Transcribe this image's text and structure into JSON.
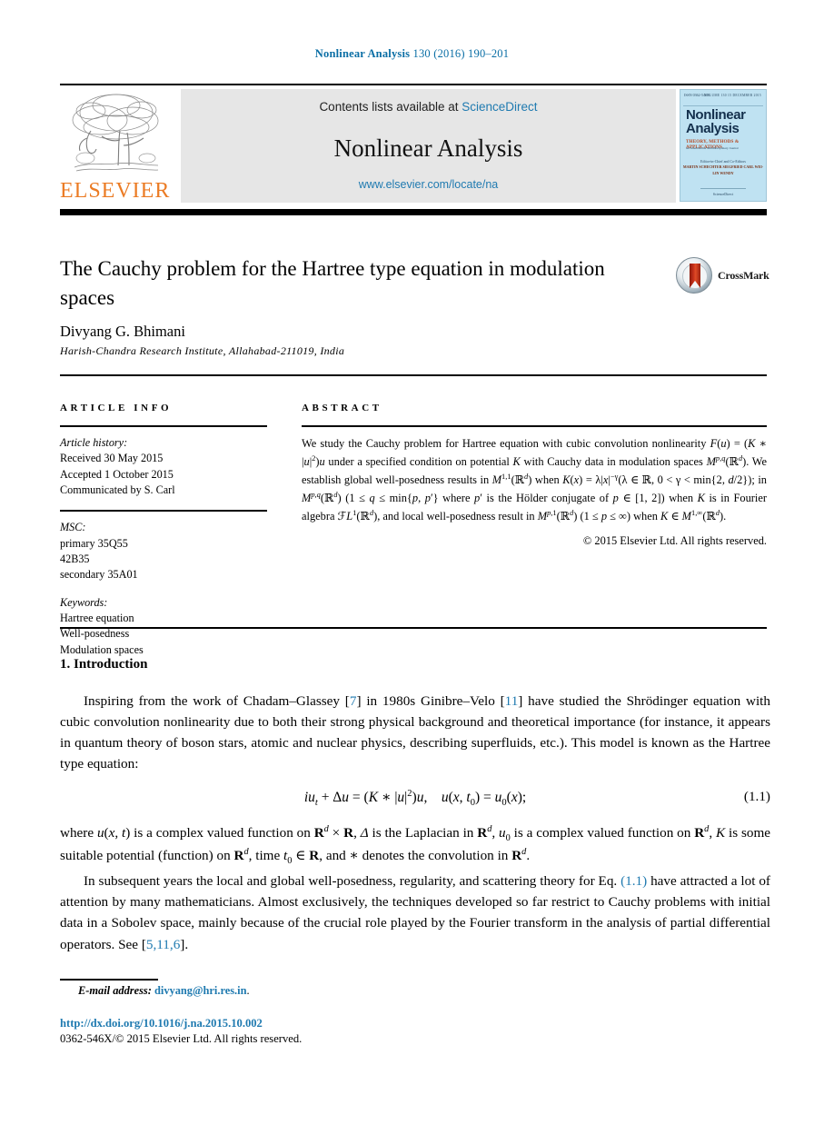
{
  "running_head": {
    "journal": "Nonlinear Analysis",
    "citation": " 130 (2016) 190–201",
    "color": "#0a6ea5"
  },
  "masthead": {
    "publisher_logo_text": "ELSEVIER",
    "publisher_color": "#eb7b24",
    "contents_prefix": "Contents lists available at ",
    "contents_link": "ScienceDirect",
    "journal_title": "Nonlinear Analysis",
    "journal_url": "www.elsevier.com/locate/na",
    "link_color": "#1f7ab0",
    "cover": {
      "issn": "ISSN 0362-546X",
      "meta": "VOLUME 130    15 DECEMBER 2015",
      "title": "Nonlinear Analysis",
      "subtitle": "THEORY, METHODS & APPLICATIONS",
      "subtitle2": "An International Multidisciplinary Journal",
      "editors_label": "Editor-in-Chief and Co-Editors",
      "editors": "MARTIN SCHECHTER\nSIEGFRIED CARL\nWEI-LIN WENDY",
      "footer": "ScienceDirect",
      "bg_color": "#bfe2f2",
      "title_color": "#14304d"
    }
  },
  "article": {
    "title": "The Cauchy problem for the Hartree type equation in modulation spaces",
    "author": "Divyang G. Bhimani",
    "affiliation": "Harish-Chandra Research Institute, Allahabad-211019, India",
    "crossmark_label": "CrossMark"
  },
  "article_info": {
    "heading": "ARTICLE INFO",
    "history_label": "Article history:",
    "history": [
      "Received 30 May 2015",
      "Accepted 1 October 2015",
      "Communicated by S. Carl"
    ],
    "msc_label": "MSC:",
    "msc": [
      "primary 35Q55",
      "42B35",
      "secondary 35A01"
    ],
    "keywords_label": "Keywords:",
    "keywords": [
      "Hartree equation",
      "Well-posedness",
      "Modulation spaces"
    ]
  },
  "abstract": {
    "heading": "ABSTRACT",
    "text_plain": "We study the Cauchy problem for Hartree equation with cubic convolution nonlinearity F(u) = (K * |u|2)u under a specified condition on potential K with Cauchy data in modulation spaces Mp,q(Rd). We establish global well-posedness results in M1,1(Rd) when K(x) = λ|x|−γ(λ ∈ R, 0 < γ < min{2, d/2}); in Mp,q(Rd) (1 ≤ q ≤ min{p, p′} where p′ is the Hölder conjugate of p ∈ [1, 2]) when K is in Fourier algebra FL1(Rd), and local well-posedness result in Mp,1(Rd) (1 ≤ p ≤ ∞) when K ∈ M1,∞(Rd).",
    "copyright": "© 2015 Elsevier Ltd. All rights reserved."
  },
  "section": {
    "number_title": "1. Introduction",
    "paragraph1_plain": "Inspiring from the work of Chadam–Glassey [7] in 1980s Ginibre–Velo [11] have studied the Shrödinger equation with cubic convolution nonlinearity due to both their strong physical background and theoretical importance (for instance, it appears in quantum theory of boson stars, atomic and nuclear physics, describing superfluids, etc.). This model is known as the Hartree type equation:",
    "citation_7": "7",
    "citation_11": "11",
    "equation_number": "(1.1)",
    "equation_plain": "iut + Δu = (K * |u|2)u,    u(x, t0) = u0(x);",
    "paragraph2_plain": "where u(x, t) is a complex valued function on Rd × R, Δ is the Laplacian in Rd, u0 is a complex valued function on Rd, K is some suitable potential (function) on Rd, time t0 ∈ R, and ∗ denotes the convolution in Rd.",
    "paragraph3_plain": "In subsequent years the local and global well-posedness, regularity, and scattering theory for Eq. (1.1) have attracted a lot of attention by many mathematicians. Almost exclusively, the techniques developed so far restrict to Cauchy problems with initial data in a Sobolev space, mainly because of the crucial role played by the Fourier transform in the analysis of partial differential operators. See [5,11,6].",
    "citation_eq": "(1.1)",
    "citation_5116": "5,11,6"
  },
  "footer": {
    "email_label": "E-mail address:",
    "email": "divyang@hri.res.in",
    "email_suffix": ".",
    "doi": "http://dx.doi.org/10.1016/j.na.2015.10.002",
    "issn_rights_prefix": "0362-546X/",
    "issn_rights": "© 2015 Elsevier Ltd. All rights reserved."
  }
}
